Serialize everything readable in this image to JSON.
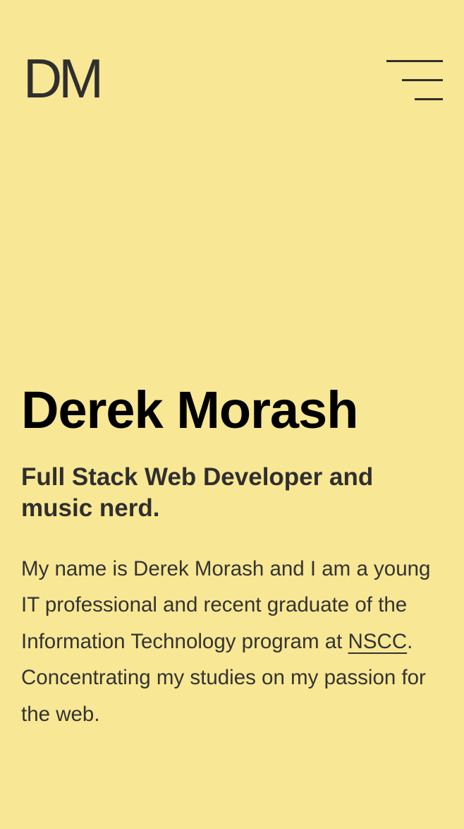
{
  "header": {
    "logo_text": "DM",
    "menu_icon": "hamburger-menu-icon"
  },
  "hero": {
    "name": "Derek Morash",
    "subtitle": "Full Stack Web Developer and music nerd.",
    "bio_before_link": "My name is Derek Morash and I am a young IT professional and recent graduate of the Information Technology program at ",
    "bio_link": "NSCC",
    "bio_after_link": ". Concentrating my studies on my passion for the web."
  },
  "colors": {
    "background": "#f8e794",
    "text": "#2f2f2f",
    "heading": "#000000"
  }
}
